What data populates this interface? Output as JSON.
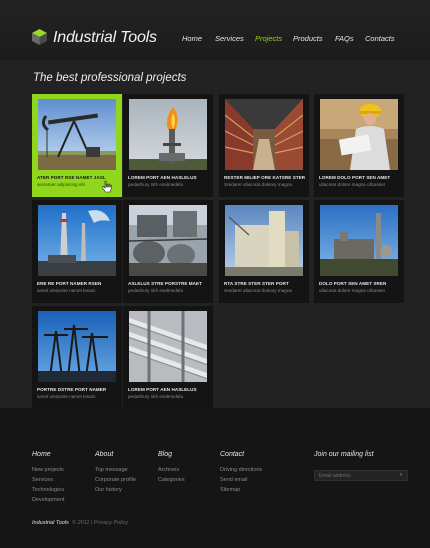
{
  "header": {
    "logo_text": "Industrial Tools",
    "nav": [
      "Home",
      "Services",
      "Projects",
      "Products",
      "FAQs",
      "Contacts"
    ],
    "active_nav": "Projects"
  },
  "main": {
    "title": "The best professional projects",
    "projects": [
      {
        "title": "ATER PORT RSE NAMET JASL",
        "subtitle": "sectetuer adipiscing elit",
        "icon": "oil-pump-image",
        "active": true
      },
      {
        "title": "LOREM PORT AEN HASLELUS",
        "subtitle": "pedashury nith esalmedela",
        "icon": "gas-flare-image"
      },
      {
        "title": "RESTER MILIEP ORE KATSRE STER",
        "subtitle": "Sredaret ullacorat doleary magna",
        "icon": "warehouse-racks-image"
      },
      {
        "title": "LOREM DOLO PORT SEN AMET",
        "subtitle": "ullacorat dolore magna ullcasser",
        "icon": "engineer-image"
      },
      {
        "title": "ERE RE PORT NAMER RSEN",
        "subtitle": "sared ulerporte namet lesam",
        "icon": "chimneys-image"
      },
      {
        "title": "ASLELUS STRE PORSTRE MAET",
        "subtitle": "pedashury nith esalmedela",
        "icon": "tanks-image"
      },
      {
        "title": "RTA STRE STER STER PORT",
        "subtitle": "Sredaret ullacorat doleary magna",
        "icon": "silo-building-image"
      },
      {
        "title": "DOLO PORT SEN AMET SREN",
        "subtitle": "ullacorat dolore magna ullcasser",
        "icon": "refinery-image"
      },
      {
        "title": "PORTRE DSTRE PORT NAMER",
        "subtitle": "sared ulerporte namet lesam",
        "icon": "cranes-image"
      },
      {
        "title": "LOREM PORT AEN HASLELUS",
        "subtitle": "pedashury nith esalmedela",
        "icon": "pipes-image"
      }
    ]
  },
  "footer": {
    "columns": [
      {
        "heading": "Home",
        "links": [
          "New projects",
          "Services",
          "Technologies",
          "Development"
        ]
      },
      {
        "heading": "About",
        "links": [
          "Top message",
          "Corporate profile",
          "Our history"
        ]
      },
      {
        "heading": "Blog",
        "links": [
          "Archives",
          "Categories"
        ]
      },
      {
        "heading": "Contact",
        "links": [
          "Driving directions",
          "Send email",
          "Sitemap"
        ]
      }
    ],
    "mailing": {
      "heading": "Join our mailing list",
      "placeholder": "Email address",
      "submit_icon": "chevron-right-icon",
      "submit_label": "›"
    },
    "copyright": {
      "brand": "Industrial Tools",
      "rest": "© 2011  |  Privacy Policy"
    }
  },
  "colors": {
    "accent": "#8fd61d",
    "background": "#1a1a1a",
    "card": "#141414"
  }
}
